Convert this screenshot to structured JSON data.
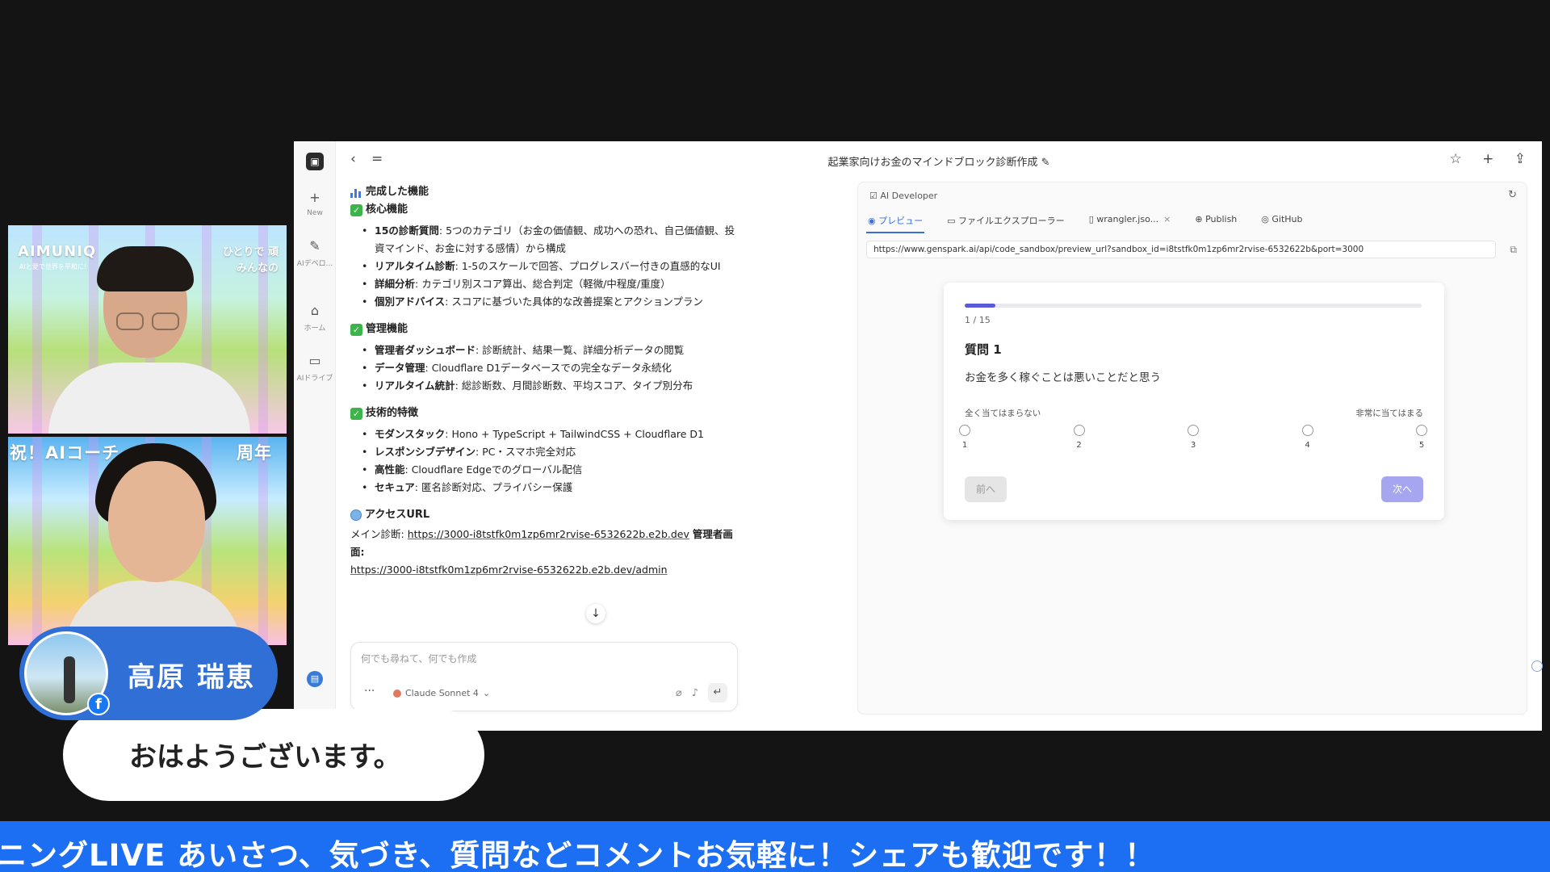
{
  "app": {
    "title": "起業家向けお金のマインドブロック診断作成 ✎",
    "rail": {
      "logo": "▣",
      "items": [
        {
          "icon": "+",
          "label": "New"
        },
        {
          "icon": "✎",
          "label": "AIデベロ..."
        },
        {
          "icon": "⌂",
          "label": "ホーム"
        },
        {
          "icon": "▭",
          "label": "AIドライブ"
        }
      ]
    },
    "nav": {
      "back": "‹",
      "menu": "="
    },
    "top_icons": "☆ + ⇪"
  },
  "chat": {
    "completed_title": "完成した機能",
    "sections": [
      {
        "title": "核心機能",
        "items": [
          {
            "b": "15の診断質問",
            "t": ": 5つのカテゴリ（お金の価値観、成功への恐れ、自己価値観、投資マインド、お金に対する感情）から構成"
          },
          {
            "b": "リアルタイム診断",
            "t": ": 1-5のスケールで回答、プログレスバー付きの直感的なUI"
          },
          {
            "b": "詳細分析",
            "t": ": カテゴリ別スコア算出、総合判定（軽微/中程度/重度）"
          },
          {
            "b": "個別アドバイス",
            "t": ": スコアに基づいた具体的な改善提案とアクションプラン"
          }
        ]
      },
      {
        "title": "管理機能",
        "items": [
          {
            "b": "管理者ダッシュボード",
            "t": ": 診断統計、結果一覧、詳細分析データの閲覧"
          },
          {
            "b": "データ管理",
            "t": ": Cloudflare D1データベースでの完全なデータ永続化"
          },
          {
            "b": "リアルタイム統計",
            "t": ": 総診断数、月間診断数、平均スコア、タイプ別分布"
          }
        ]
      },
      {
        "title": "技術的特徴",
        "items": [
          {
            "b": "モダンスタック",
            "t": ": Hono + TypeScript + TailwindCSS + Cloudflare D1"
          },
          {
            "b": "レスポンシブデザイン",
            "t": ": PC・スマホ完全対応"
          },
          {
            "b": "高性能",
            "t": ": Cloudflare Edgeでのグローバル配信"
          },
          {
            "b": "セキュア",
            "t": ": 匿名診断対応、プライバシー保護"
          }
        ]
      }
    ],
    "access_title": "アクセスURL",
    "main_label": "メイン診断:",
    "main_url": "https://3000-i8tstfk0m1zp6mr2rvise-6532622b.e2b.dev",
    "admin_label": "管理者画面:",
    "admin_url": "https://3000-i8tstfk0m1zp6mr2rvise-6532622b.e2b.dev/admin",
    "scroll_icon": "↓"
  },
  "composer": {
    "placeholder": "何でも尋ねて、何でも作成",
    "more": "···",
    "model": "Claude Sonnet 4",
    "model_caret": "⌄",
    "attach_icon": "⌀",
    "mic_icon": "♪",
    "send_icon": "↵"
  },
  "dev": {
    "header": "AI Developer",
    "refresh_icon": "↻",
    "tabs": [
      {
        "icon": "◉",
        "label": "プレビュー",
        "active": true
      },
      {
        "icon": "▭",
        "label": "ファイルエクスプローラー"
      },
      {
        "icon": "▯",
        "label": "wrangler.jso...",
        "close": "×"
      },
      {
        "icon": "⊕",
        "label": "Publish"
      },
      {
        "icon": "◎",
        "label": "GitHub"
      }
    ],
    "url": "https://www.genspark.ai/api/code_sandbox/preview_url?sandbox_id=i8tstfk0m1zp6mr2rvise-6532622b&port=3000",
    "ext_icon": "⧉"
  },
  "quiz": {
    "progress": 0.067,
    "count": "1 / 15",
    "title": "質問 1",
    "question": "お金を多く稼ぐことは悪いことだと思う",
    "scale_low": "全く当てはまらない",
    "scale_high": "非常に当てはまる",
    "options": [
      "1",
      "2",
      "3",
      "4",
      "5"
    ],
    "prev": "前へ",
    "next": "次へ"
  },
  "cams": {
    "cam1_brand": "AIMUNIQ",
    "cam1_sub": "AIと愛で世界を平和に!",
    "cam1_tag_line1": "ひとりで 頑",
    "cam1_tag_line2": "みんなの",
    "cam2_banner_left": "祝！AIコーチ",
    "cam2_banner_right": "周年"
  },
  "presenter": {
    "name": "高原 瑞恵",
    "fb": "f",
    "greeting": "おはようございます。"
  },
  "ticker": "ニングLIVE あいさつ、気づき、質問などコメントお気軽に！シェアも歓迎です！！",
  "colors": {
    "accent": "#3a6fd8",
    "progress": "#5b5bd6",
    "next_button": "#a6a6f0",
    "ticker_bg": "#1c6ef2",
    "namecard_bg": "#2f6fd6"
  }
}
